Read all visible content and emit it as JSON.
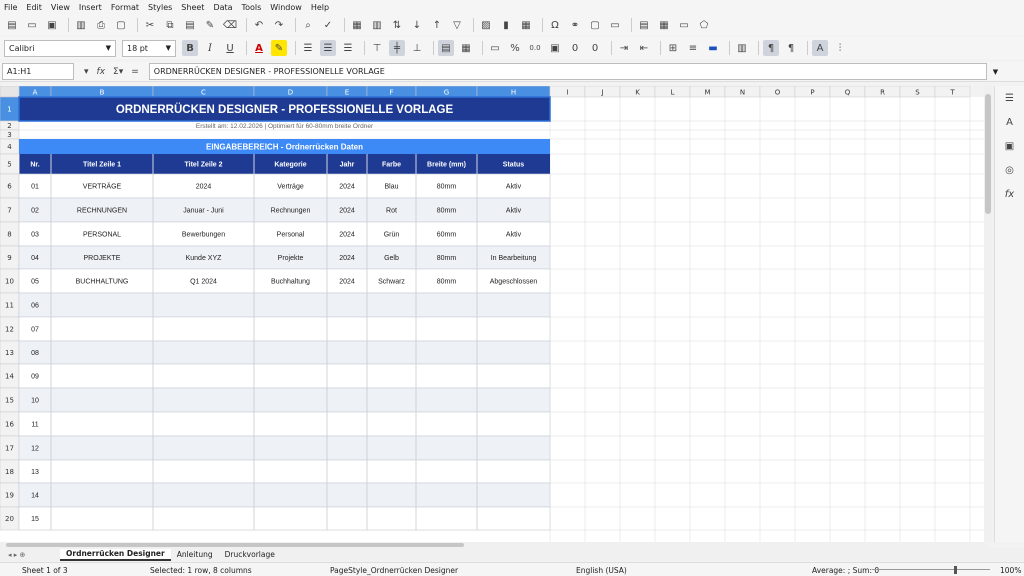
{
  "menu": [
    "File",
    "Edit",
    "View",
    "Insert",
    "Format",
    "Styles",
    "Sheet",
    "Data",
    "Tools",
    "Window",
    "Help"
  ],
  "toolbar": {
    "font_name": "Calibri",
    "font_size": "18 pt",
    "bold_label": "B",
    "italic_label": "I",
    "underline_label": "U",
    "percent_label": "%",
    "decimal_label": "0.0"
  },
  "formula_bar": {
    "name_box": "A1:H1",
    "content": "ORDNERRÜCKEN DESIGNER - PROFESSIONELLE VORLAGE"
  },
  "columns": [
    "A",
    "B",
    "C",
    "D",
    "E",
    "F",
    "G",
    "H",
    "I",
    "J",
    "K",
    "L",
    "M",
    "N",
    "O",
    "P",
    "Q",
    "R",
    "S",
    "T"
  ],
  "row_numbers": [
    "1",
    "2",
    "3",
    "4",
    "5",
    "6",
    "7",
    "8",
    "9",
    "10",
    "11",
    "12",
    "13",
    "14",
    "15",
    "16",
    "17",
    "18",
    "19",
    "20"
  ],
  "sheet": {
    "title": "ORDNERRÜCKEN DESIGNER - PROFESSIONELLE VORLAGE",
    "subtitle": "Erstellt am: 12.02.2026 | Optimiert für 60-80mm breite Ordner",
    "section_header": "EINGABEBEREICH - Ordnerrücken Daten",
    "headers": [
      "Nr.",
      "Titel Zeile 1",
      "Titel Zeile 2",
      "Kategorie",
      "Jahr",
      "Farbe",
      "Breite (mm)",
      "Status"
    ],
    "rows": [
      [
        "01",
        "VERTRÄGE",
        "2024",
        "Verträge",
        "2024",
        "Blau",
        "80mm",
        "Aktiv"
      ],
      [
        "02",
        "RECHNUNGEN",
        "Januar - Juni",
        "Rechnungen",
        "2024",
        "Rot",
        "80mm",
        "Aktiv"
      ],
      [
        "03",
        "PERSONAL",
        "Bewerbungen",
        "Personal",
        "2024",
        "Grün",
        "60mm",
        "Aktiv"
      ],
      [
        "04",
        "PROJEKTE",
        "Kunde XYZ",
        "Projekte",
        "2024",
        "Gelb",
        "80mm",
        "In Bearbeitung"
      ],
      [
        "05",
        "BUCHHALTUNG",
        "Q1 2024",
        "Buchhaltung",
        "2024",
        "Schwarz",
        "80mm",
        "Abgeschlossen"
      ],
      [
        "06",
        "",
        "",
        "",
        "",
        "",
        "",
        ""
      ],
      [
        "07",
        "",
        "",
        "",
        "",
        "",
        "",
        ""
      ],
      [
        "08",
        "",
        "",
        "",
        "",
        "",
        "",
        ""
      ],
      [
        "09",
        "",
        "",
        "",
        "",
        "",
        "",
        ""
      ],
      [
        "10",
        "",
        "",
        "",
        "",
        "",
        "",
        ""
      ],
      [
        "11",
        "",
        "",
        "",
        "",
        "",
        "",
        ""
      ],
      [
        "12",
        "",
        "",
        "",
        "",
        "",
        "",
        ""
      ],
      [
        "13",
        "",
        "",
        "",
        "",
        "",
        "",
        ""
      ],
      [
        "14",
        "",
        "",
        "",
        "",
        "",
        "",
        ""
      ],
      [
        "15",
        "",
        "",
        "",
        "",
        "",
        "",
        ""
      ]
    ]
  },
  "sheet_tabs": [
    "Ordnerrücken Designer",
    "Anleitung",
    "Druckvorlage"
  ],
  "active_tab": "Ordnerrücken Designer",
  "status": {
    "sheet": "Sheet 1 of 3",
    "selection": "Selected: 1 row, 8 columns",
    "page_style": "PageStyle_Ordnerrücken Designer",
    "language": "English (USA)",
    "sum": "Average: ; Sum: 0",
    "zoom": "100%"
  },
  "colors": {
    "title_bg": "#1f3a93",
    "section_bg": "#3d8af7",
    "header_bg": "#1f3a93",
    "alt_row": "#eef1f5",
    "col_header_selected": "#4a90e2"
  },
  "icons": {
    "toolbar1": [
      "new-icon",
      "open-icon",
      "save-icon",
      "export-pdf-icon",
      "print-icon",
      "print-preview-icon",
      "cut-icon",
      "copy-icon",
      "paste-icon",
      "clone-format-icon",
      "clear-icon",
      "undo-icon",
      "redo-icon",
      "find-replace-icon",
      "spelling-icon",
      "row-icon",
      "column-icon",
      "sort-icon",
      "sort-ascending-icon",
      "sort-descending-icon",
      "autofilter-icon",
      "image-icon",
      "chart-icon",
      "pivot-icon",
      "special-char-icon",
      "hyperlink-icon",
      "comment-icon",
      "headers-footers-icon",
      "define-print-area-icon",
      "freeze-icon",
      "split-window-icon",
      "show-draw-icon"
    ],
    "sidebar": [
      "properties-icon",
      "styles-icon",
      "gallery-icon",
      "navigator-icon",
      "functions-icon"
    ]
  }
}
